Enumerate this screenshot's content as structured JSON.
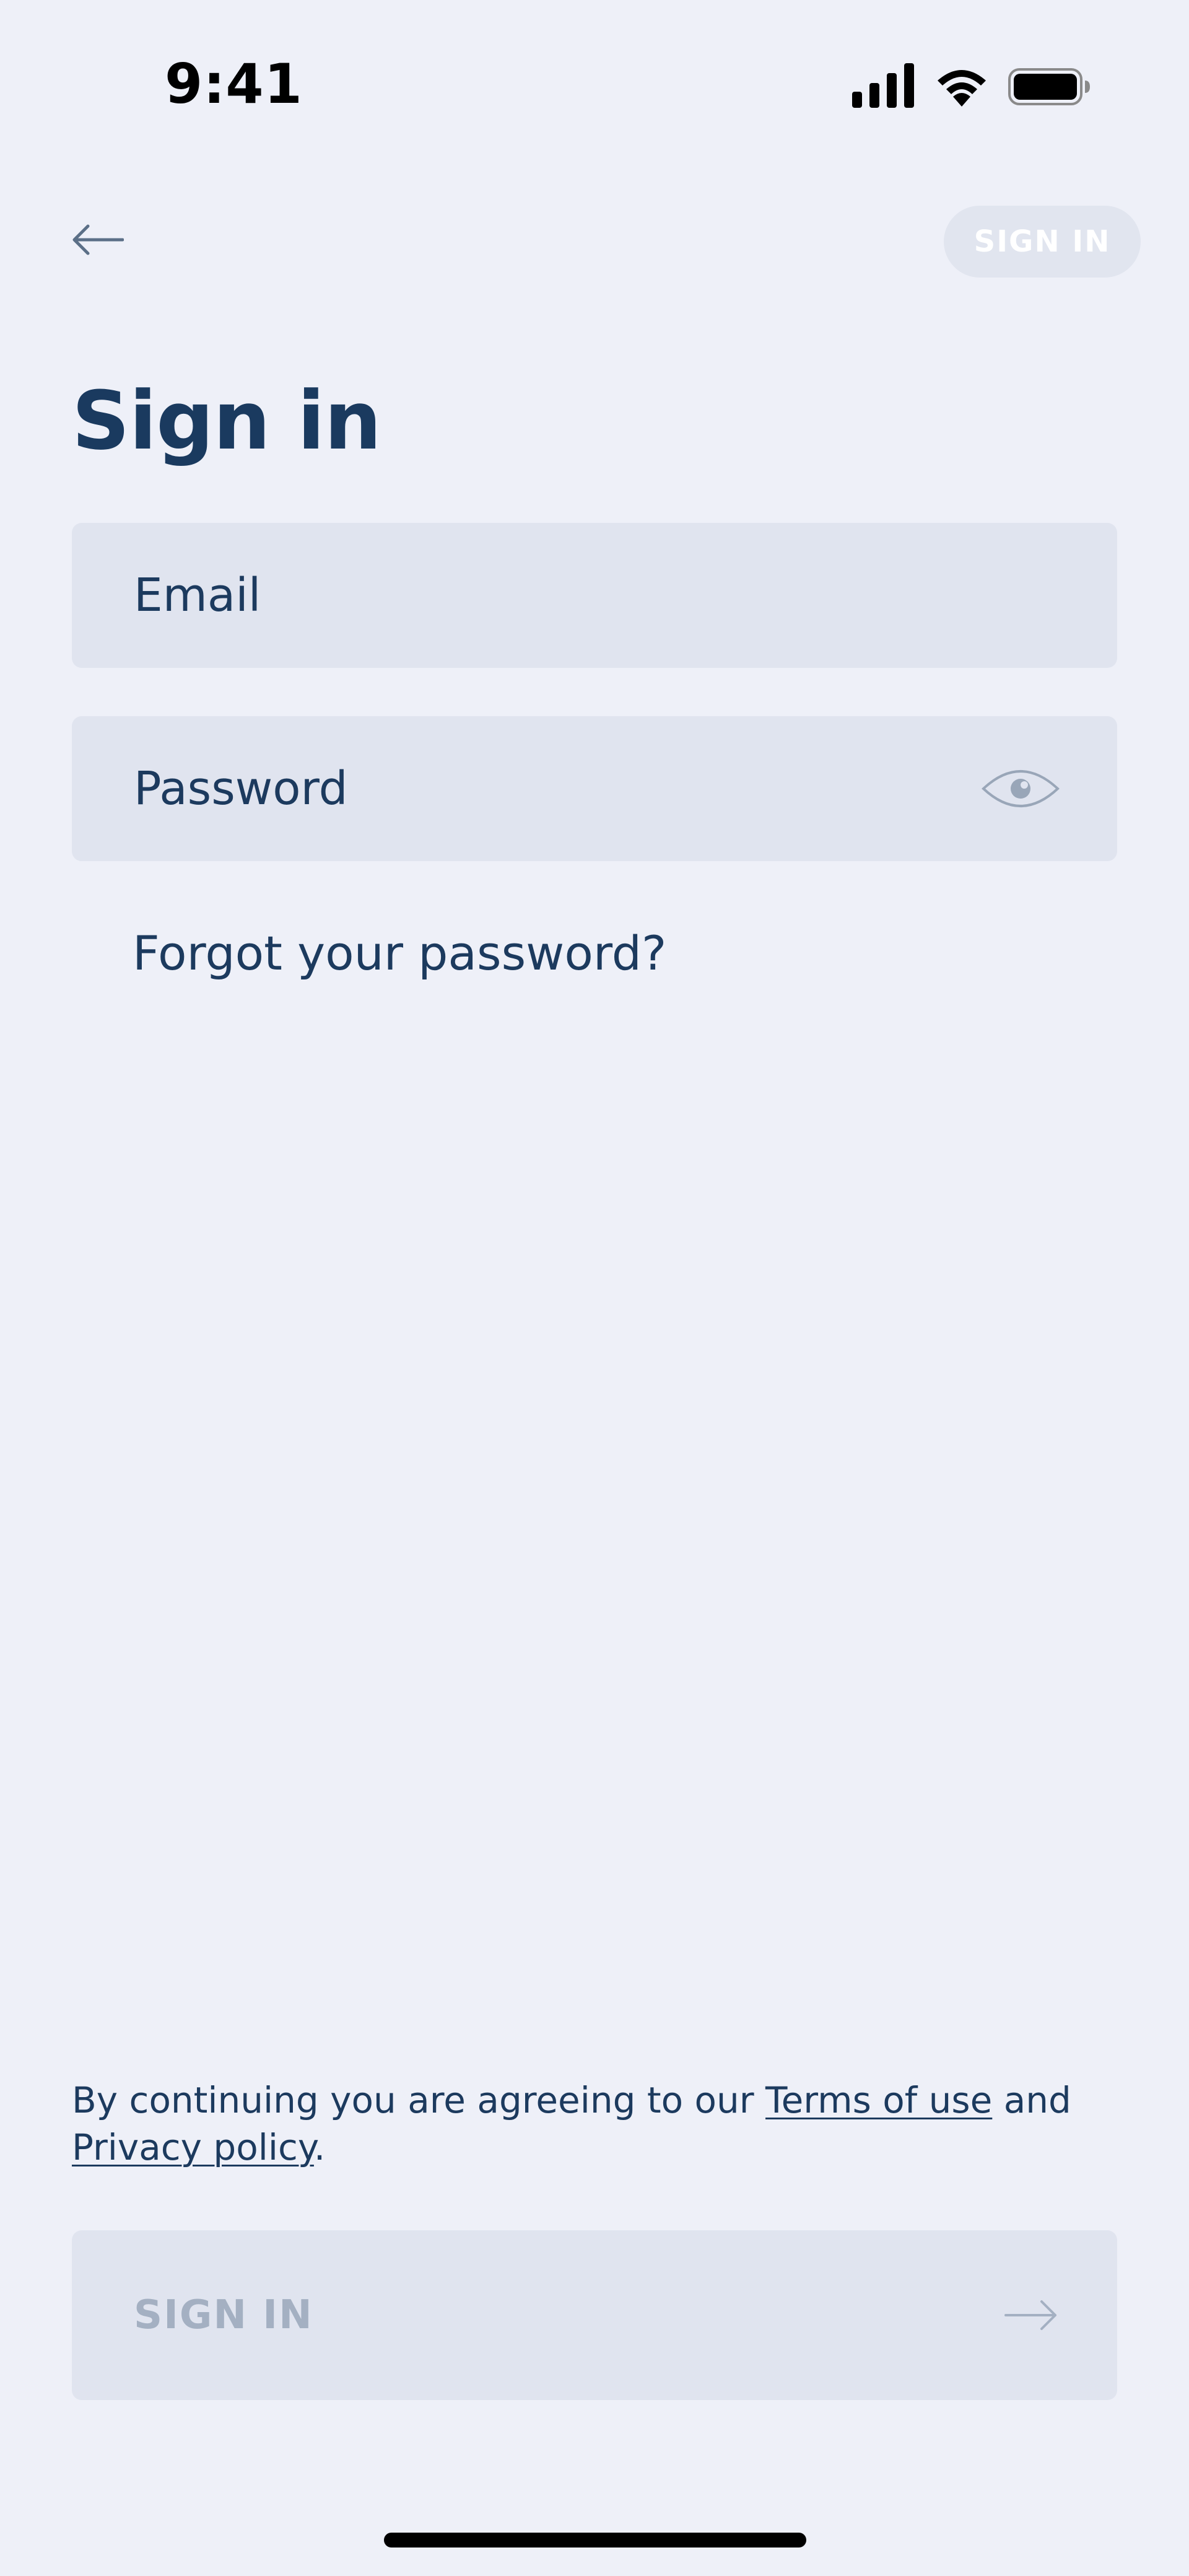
{
  "status_bar": {
    "time": "9:41",
    "icons": [
      "cellular-signal-icon",
      "wifi-icon",
      "battery-icon"
    ]
  },
  "header": {
    "back_icon": "arrow-left-icon",
    "signin_label": "SIGN IN"
  },
  "page": {
    "title": "Sign in"
  },
  "form": {
    "email_placeholder": "Email",
    "password_placeholder": "Password",
    "password_toggle_icon": "eye-icon",
    "forgot_label": "Forgot your password?"
  },
  "legal": {
    "prefix": "By continuing you are agreeing to our ",
    "terms_label": "Terms of use",
    "middle": " and ",
    "privacy_label": "Privacy policy",
    "suffix": "."
  },
  "footer": {
    "signin_label": "SIGN IN",
    "arrow_icon": "arrow-right-icon"
  },
  "colors": {
    "background": "#eef0f8",
    "field_background": "#e0e4ef",
    "text_primary": "#1c3a5e",
    "text_disabled": "#a4b0c2"
  }
}
